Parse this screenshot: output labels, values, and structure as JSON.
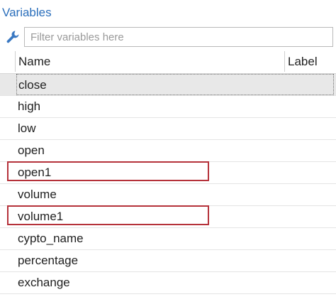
{
  "panel": {
    "title": "Variables"
  },
  "filter": {
    "placeholder": "Filter variables here",
    "value": ""
  },
  "table": {
    "columns": {
      "name": "Name",
      "label": "Label"
    },
    "rows": [
      {
        "name": "close",
        "label": "",
        "selected": true
      },
      {
        "name": "high",
        "label": ""
      },
      {
        "name": "low",
        "label": ""
      },
      {
        "name": "open",
        "label": ""
      },
      {
        "name": "open1",
        "label": "",
        "highlighted": true
      },
      {
        "name": "volume",
        "label": ""
      },
      {
        "name": "volume1",
        "label": "",
        "highlighted": true
      },
      {
        "name": "cypto_name",
        "label": ""
      },
      {
        "name": "percentage",
        "label": ""
      },
      {
        "name": "exchange",
        "label": ""
      }
    ]
  },
  "colors": {
    "title": "#2a6ebb",
    "wrench_icon": "#3a78c2",
    "highlight_box": "#b5323a",
    "selected_row": "#e8e8e8"
  }
}
